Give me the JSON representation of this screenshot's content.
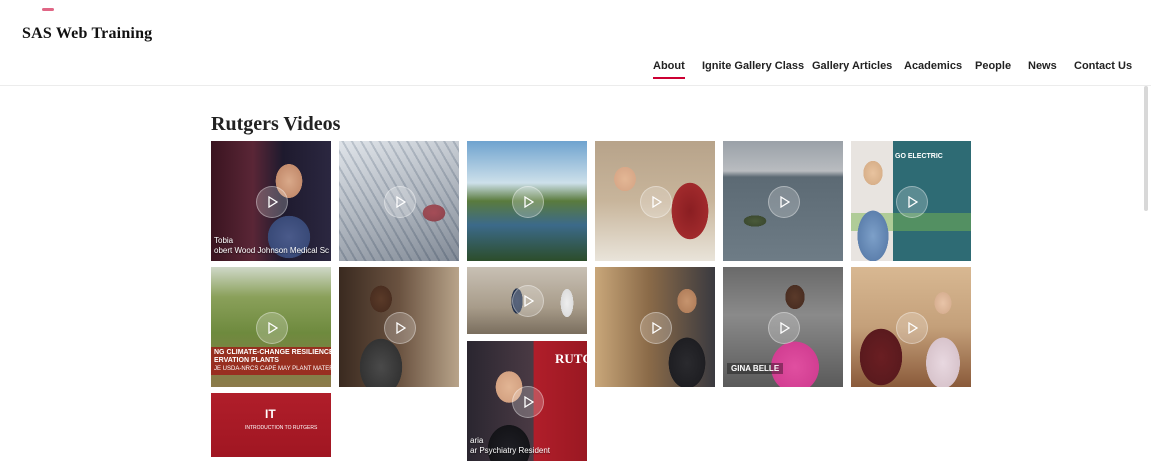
{
  "site": {
    "title": "SAS Web Training"
  },
  "nav": {
    "items": [
      {
        "label": "About",
        "active": true
      },
      {
        "label": "Ignite Gallery Class"
      },
      {
        "label": "Gallery Articles"
      },
      {
        "label": "Academics"
      },
      {
        "label": "People"
      },
      {
        "label": "News"
      },
      {
        "label": "Contact Us"
      }
    ]
  },
  "colors": {
    "accent": "#cc0033"
  },
  "section": {
    "title": "Rutgers Videos"
  },
  "videos": [
    {
      "caption_line1": "Tobia",
      "caption_line2": "obert Wood Johnson Medical Sc",
      "icon": "play-icon"
    },
    {
      "icon": "play-icon"
    },
    {
      "icon": "play-icon"
    },
    {
      "icon": "play-icon"
    },
    {
      "icon": "play-icon"
    },
    {
      "icon": "play-icon",
      "poster_text": "GO ELECTRIC"
    },
    {
      "icon": "play-icon",
      "overlay_line1": "NG CLIMATE-CHANGE RESILIENCE",
      "overlay_line2": "ERVATION PLANTS",
      "overlay_line3": "JE USDA-NRCS CAPE MAY PLANT MATERIALS CENT"
    },
    {
      "icon": "play-icon"
    },
    {
      "icon": "play-icon"
    },
    {
      "icon": "play-icon"
    },
    {
      "icon": "play-icon",
      "name_text": "GINA BELLE"
    },
    {
      "icon": "play-icon"
    },
    {
      "icon": "play-icon",
      "title_text": "IT",
      "subtitle_text": "INTRODUCTION TO RUTGERS"
    },
    {
      "icon": "play-icon",
      "caption_line1": "aria",
      "caption_line2": "ar Psychiatry Resident",
      "banner_text": "RUTGE"
    }
  ]
}
